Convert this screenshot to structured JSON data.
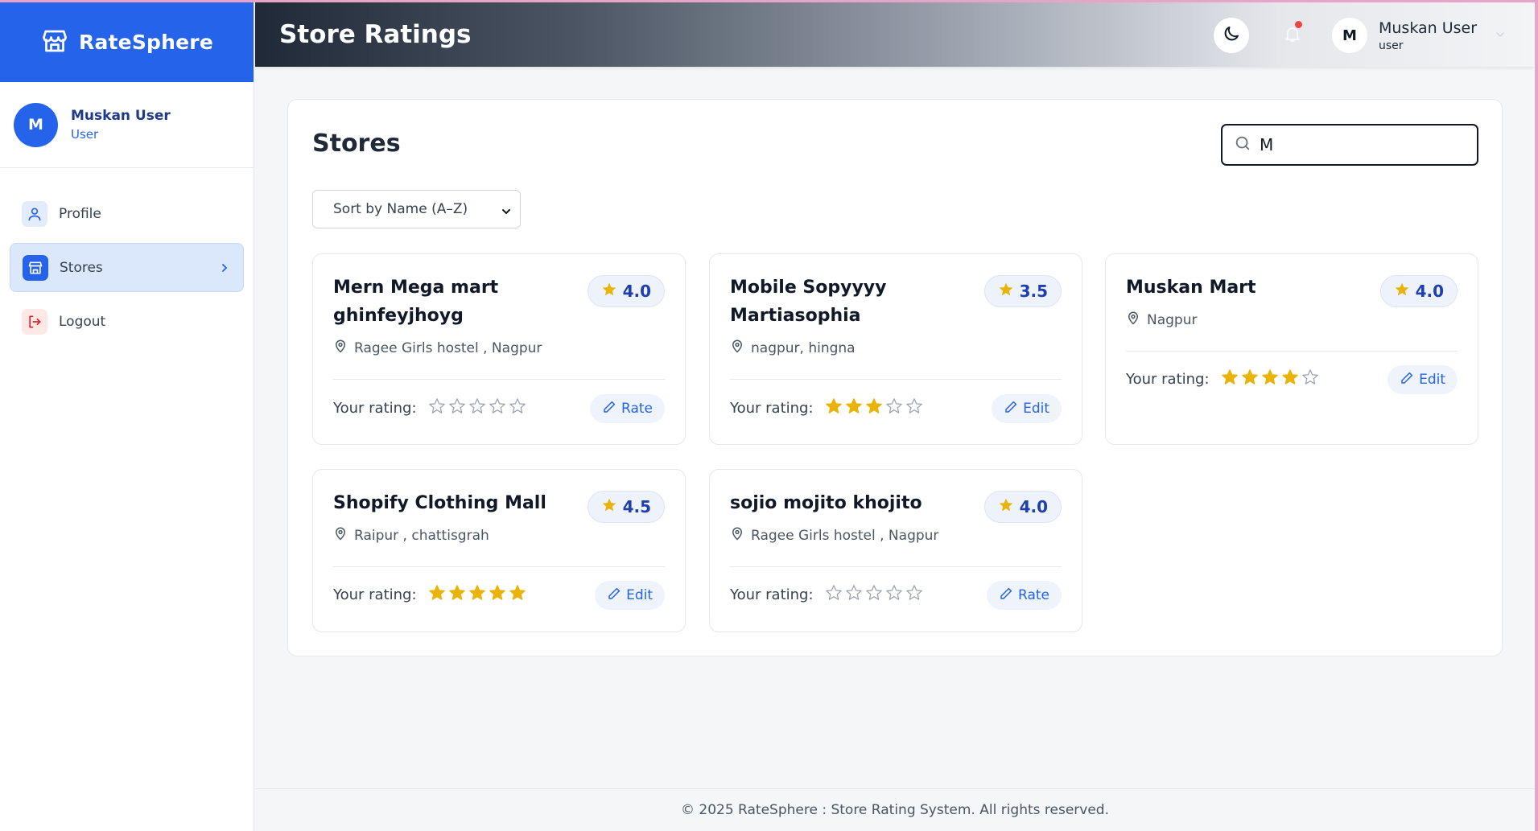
{
  "app": {
    "brand": "RateSphere",
    "header_title": "Store Ratings"
  },
  "sidebar": {
    "user": {
      "initial": "M",
      "name": "Muskan User",
      "role": "User"
    },
    "items": [
      {
        "label": "Profile",
        "icon": "user-icon"
      },
      {
        "label": "Stores",
        "icon": "store-icon",
        "active": true
      },
      {
        "label": "Logout",
        "icon": "logout-icon"
      }
    ]
  },
  "header": {
    "user": {
      "initial": "M",
      "name": "Muskan User",
      "role": "user"
    },
    "has_notification": true
  },
  "main": {
    "title": "Stores",
    "search": {
      "value": "M",
      "placeholder": ""
    },
    "sort": {
      "selected": "Sort by Name (A–Z)"
    },
    "your_rating_label": "Your rating:",
    "stores": [
      {
        "name": "Mern Mega mart ghinfeyjhoyg",
        "avg": "4.0",
        "location": "Ragee Girls hostel , Nagpur",
        "user_rating": 0,
        "action": "Rate"
      },
      {
        "name": "Mobile Sopyyyy Martiasophia",
        "avg": "3.5",
        "location": "nagpur, hingna",
        "user_rating": 3,
        "action": "Edit"
      },
      {
        "name": "Muskan Mart",
        "avg": "4.0",
        "location": "Nagpur",
        "user_rating": 4,
        "action": "Edit"
      },
      {
        "name": "Shopify Clothing Mall",
        "avg": "4.5",
        "location": "Raipur , chattisgrah",
        "user_rating": 5,
        "action": "Edit"
      },
      {
        "name": "sojio mojito khojito",
        "avg": "4.0",
        "location": "Ragee Girls hostel , Nagpur",
        "user_rating": 0,
        "action": "Rate"
      }
    ]
  },
  "footer": {
    "text": "© 2025 RateSphere : Store Rating System. All rights reserved."
  },
  "colors": {
    "brand": "#2563eb",
    "star_filled": "#eab308",
    "star_empty": "#9ca3af",
    "logout": "#dc2626"
  }
}
